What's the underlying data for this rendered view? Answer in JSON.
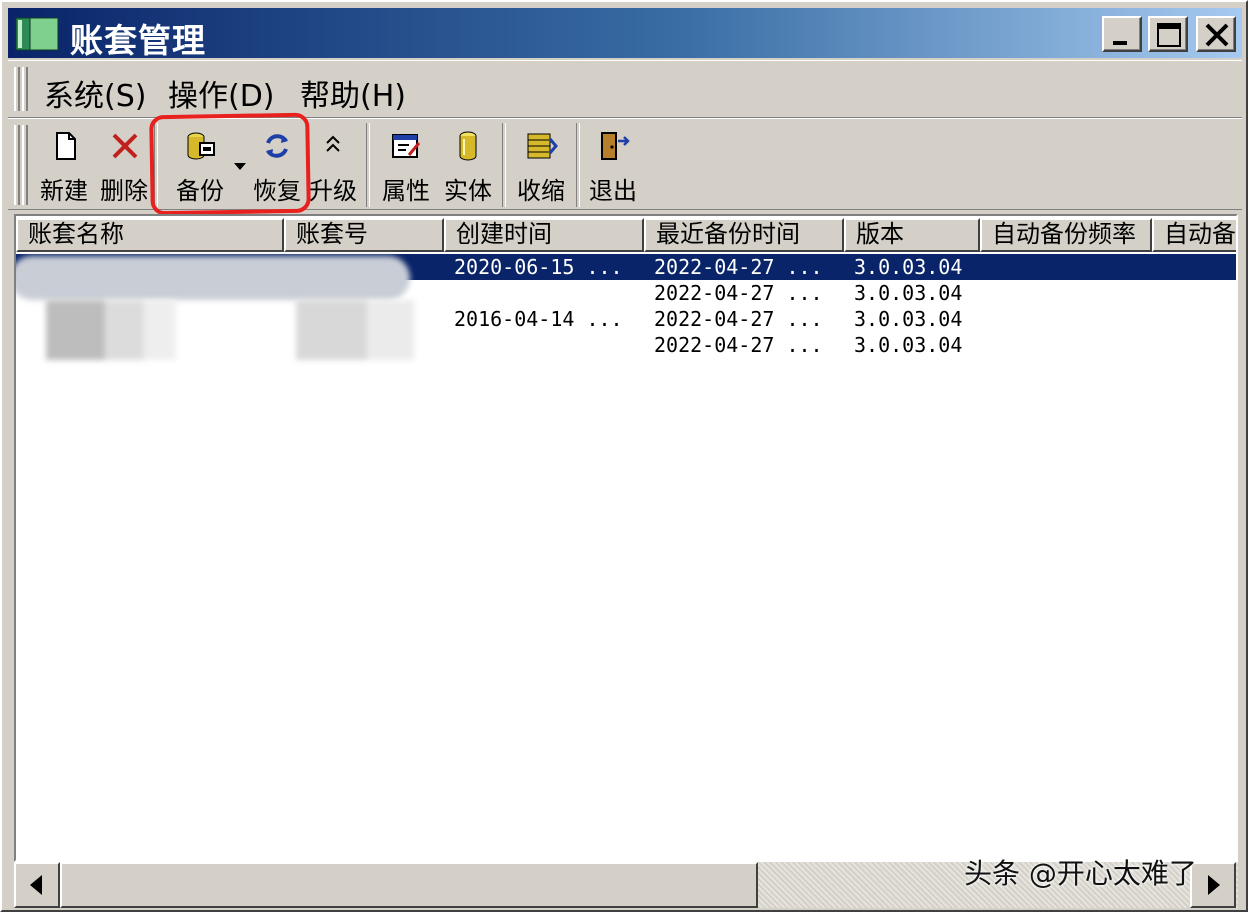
{
  "window": {
    "title": "账套管理"
  },
  "menubar": {
    "items": [
      {
        "label": "系统(S)"
      },
      {
        "label": "操作(D)"
      },
      {
        "label": "帮助(H)"
      }
    ]
  },
  "toolbar": {
    "new_label": "新建",
    "delete_label": "删除",
    "backup_label": "备份",
    "restore_label": "恢复",
    "upgrade_label": "升级",
    "properties_label": "属性",
    "entity_label": "实体",
    "compress_label": "收缩",
    "exit_label": "退出"
  },
  "list": {
    "columns": [
      "账套名称",
      "账套号",
      "创建时间",
      "最近备份时间",
      "版本",
      "自动备份频率",
      "自动备"
    ],
    "rows": [
      {
        "created": "2020-06-15 ...",
        "last_backup": "2022-04-27 ...",
        "version": "3.0.03.04",
        "selected": true
      },
      {
        "created": "",
        "last_backup": "2022-04-27 ...",
        "version": "3.0.03.04",
        "selected": false
      },
      {
        "created": "2016-04-14 ...",
        "last_backup": "2022-04-27 ...",
        "version": "3.0.03.04",
        "selected": false
      },
      {
        "created": "",
        "last_backup": "2022-04-27 ...",
        "version": "3.0.03.04",
        "selected": false
      }
    ]
  },
  "watermark": "头条 @开心太难了",
  "colors": {
    "title_gradient_start": "#0a246a",
    "title_gradient_end": "#a6caf0",
    "selection": "#0a246a",
    "highlight_box": "#e8201e",
    "window_face": "#d4d0c8"
  }
}
